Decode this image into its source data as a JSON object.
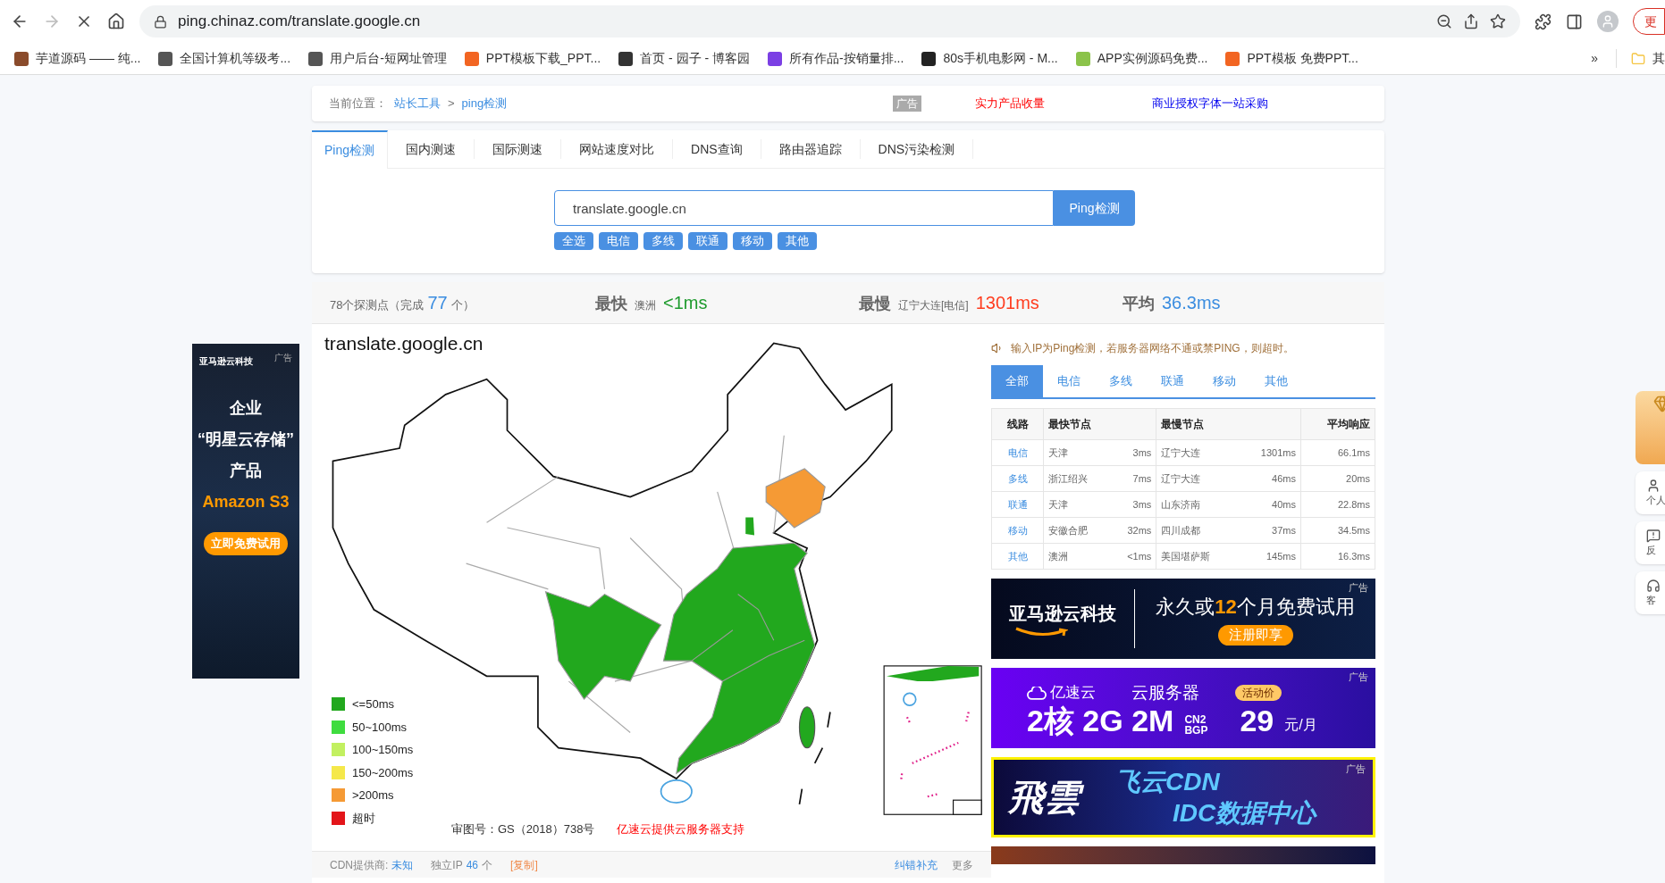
{
  "browser": {
    "url": "ping.chinaz.com/translate.google.cn",
    "update_button": "更",
    "bookmarks": [
      {
        "label": "芋道源码 —— 纯...",
        "color": "#8a4b2b"
      },
      {
        "label": "全国计算机等级考...",
        "color": "#555555"
      },
      {
        "label": "用户后台-短网址管理",
        "color": "#555555"
      },
      {
        "label": "PPT模板下载_PPT...",
        "color": "#f26522"
      },
      {
        "label": "首页 - 园子 - 博客园",
        "color": "#333333"
      },
      {
        "label": "所有作品-按销量排...",
        "color": "#7b3fe4"
      },
      {
        "label": "80s手机电影网 - M...",
        "color": "#222222"
      },
      {
        "label": "APP实例源码免费...",
        "color": "#8bc34a"
      },
      {
        "label": "PPT模板 免费PPT...",
        "color": "#f26522"
      }
    ],
    "more": "»",
    "other_folder": "其"
  },
  "breadcrumb": {
    "label": "当前位置：",
    "items": [
      "站长工具",
      "ping检测"
    ],
    "separator": ">",
    "ad_badge": "广告",
    "promo_red": "实力产品收量",
    "promo_blue": "商业授权字体一站采购"
  },
  "tabs": [
    {
      "label": "Ping检测",
      "selected": true
    },
    {
      "label": "国内测速",
      "selected": false
    },
    {
      "label": "国际测速",
      "selected": false
    },
    {
      "label": "网站速度对比",
      "selected": false
    },
    {
      "label": "DNS查询",
      "selected": false
    },
    {
      "label": "路由器追踪",
      "selected": false
    },
    {
      "label": "DNS污染检测",
      "selected": false
    }
  ],
  "search": {
    "value": "translate.google.cn",
    "button": "Ping检测",
    "filters": [
      "全选",
      "电信",
      "多线",
      "联通",
      "移动",
      "其他"
    ]
  },
  "stats": {
    "points": "78个探测点（完成",
    "done": "77",
    "done_suffix": "个）",
    "fastest_label": "最快",
    "fastest_where": "澳洲",
    "fastest_value": "<1ms",
    "slowest_label": "最慢",
    "slowest_where": "辽宁大连[电信]",
    "slowest_value": "1301ms",
    "average_label": "平均",
    "average_value": "36.3ms"
  },
  "map": {
    "title": "translate.google.cn",
    "legend": [
      {
        "label": "<=50ms",
        "color": "#22a81e"
      },
      {
        "label": "50~100ms",
        "color": "#3fdc3f"
      },
      {
        "label": "100~150ms",
        "color": "#c2f060"
      },
      {
        "label": "150~200ms",
        "color": "#f5e84a"
      },
      {
        "label": ">200ms",
        "color": "#f59a35"
      },
      {
        "label": "超时",
        "color": "#e3151a"
      }
    ],
    "approval": "审图号：GS（2018）738号",
    "sponsor": "亿速云提供云服务器支持"
  },
  "notice": "输入IP为Ping检测，若服务器网络不通或禁PING，则超时。",
  "line_tabs": [
    {
      "label": "全部",
      "selected": true
    },
    {
      "label": "电信",
      "selected": false
    },
    {
      "label": "多线",
      "selected": false
    },
    {
      "label": "联通",
      "selected": false
    },
    {
      "label": "移动",
      "selected": false
    },
    {
      "label": "其他",
      "selected": false
    }
  ],
  "table": {
    "columns": [
      "线路",
      "最快节点",
      "最慢节点",
      "平均响应"
    ],
    "rows": [
      {
        "line": "电信",
        "fast_node": "天津",
        "fast_ms": "3ms",
        "slow_node": "辽宁大连",
        "slow_ms": "1301ms",
        "avg": "66.1ms"
      },
      {
        "line": "多线",
        "fast_node": "浙江绍兴",
        "fast_ms": "7ms",
        "slow_node": "辽宁大连",
        "slow_ms": "46ms",
        "avg": "20ms"
      },
      {
        "line": "联通",
        "fast_node": "天津",
        "fast_ms": "3ms",
        "slow_node": "山东济南",
        "slow_ms": "40ms",
        "avg": "22.8ms"
      },
      {
        "line": "移动",
        "fast_node": "安徽合肥",
        "fast_ms": "32ms",
        "slow_node": "四川成都",
        "slow_ms": "37ms",
        "avg": "34.5ms"
      },
      {
        "line": "其他",
        "fast_node": "澳洲",
        "fast_ms": "<1ms",
        "slow_node": "美国堪萨斯",
        "slow_ms": "145ms",
        "avg": "16.3ms"
      }
    ]
  },
  "left_ad": {
    "brand": "亚马逊云科技",
    "badge": "广告",
    "lines": [
      "企业",
      "“明星云存储”",
      "产品"
    ],
    "product": "Amazon S3",
    "button": "立即免费试用"
  },
  "right_ads": [
    {
      "kind": "amazon",
      "badge": "广告",
      "brand": "亚马逊云科技",
      "headline": [
        {
          "text": "永久或",
          "highlight": false
        },
        {
          "text": "12",
          "highlight": true
        },
        {
          "text": "个月免费试用",
          "highlight": false
        }
      ],
      "button": "注册即享"
    },
    {
      "kind": "yisu",
      "badge": "广告",
      "brand": "亿速云",
      "product": "云服务器",
      "tag": "活动价",
      "spec": "2核 2G 2M",
      "net_top": "CN2",
      "net_bottom": "BGP",
      "price": "29",
      "unit": "元/月"
    },
    {
      "kind": "feiyun",
      "badge": "广告",
      "logo": "飛雲",
      "title": "飞云CDN",
      "subtitle": "IDC数据中心"
    },
    {
      "kind": "partial"
    }
  ],
  "footer": {
    "cdn_label": "CDN提供商:",
    "cdn_value": "未知",
    "ip_label": "独立IP",
    "ip_count": "46",
    "ip_unit": "个",
    "copy": "[复制]",
    "correct": "纠错补充",
    "more": "更多"
  },
  "side": {
    "buttons": [
      "个人",
      "反",
      "客"
    ]
  }
}
